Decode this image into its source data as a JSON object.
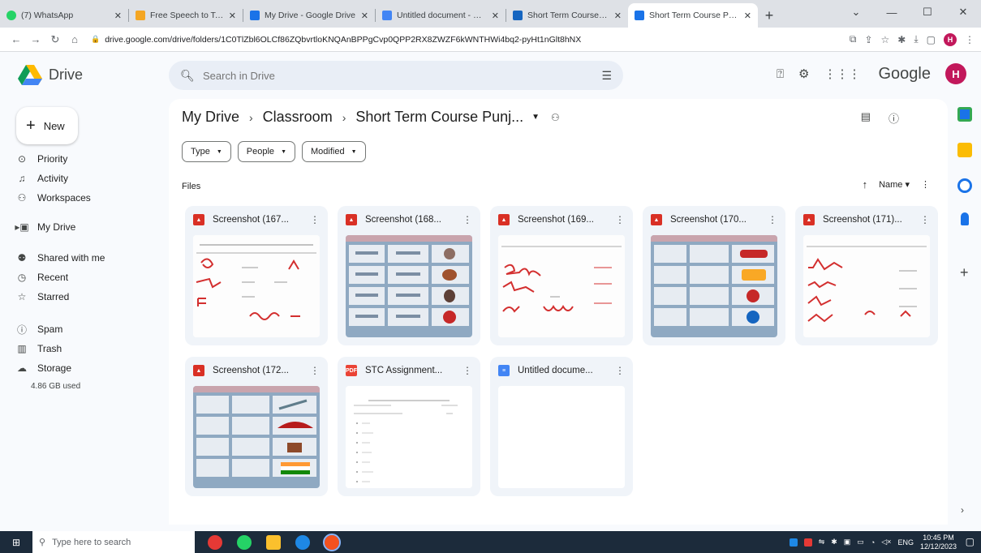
{
  "browser": {
    "tabs": [
      {
        "title": "(7) WhatsApp",
        "favicon_color": "#25d366",
        "active": false
      },
      {
        "title": "Free Speech to Text Online",
        "favicon_color": "#f4a623",
        "active": false
      },
      {
        "title": "My Drive - Google Drive",
        "favicon_color": "#1a73e8",
        "active": false
      },
      {
        "title": "Untitled document - Goog",
        "favicon_color": "#4285f4",
        "active": false
      },
      {
        "title": "Short Term Course Punjab",
        "favicon_color": "#1565c0",
        "active": false
      },
      {
        "title": "Short Term Course Punjab",
        "favicon_color": "#1a73e8",
        "active": true
      }
    ],
    "new_tab_glyph": "+",
    "url": "drive.google.com/drive/folders/1C0TlZbl6OLCf86ZQbvrtloKNQAnBPPgCvp0QPP2RX8ZWZF6kWNTHWi4bq2-pyHt1nGlt8hNX",
    "profile_initial": "H"
  },
  "drive": {
    "app_name": "Drive",
    "search_placeholder": "Search in Drive",
    "brand_word": "Google",
    "avatar_initial": "H",
    "new_label": "New",
    "nav": [
      {
        "label": "Priority",
        "icon": "priority-icon",
        "glyph": "⊙"
      },
      {
        "label": "Activity",
        "icon": "activity-icon",
        "glyph": "♫"
      },
      {
        "label": "Workspaces",
        "icon": "workspaces-icon",
        "glyph": "⚇"
      },
      {
        "label": "My Drive",
        "icon": "my-drive-icon",
        "glyph": "▣"
      },
      {
        "label": "Shared with me",
        "icon": "shared-icon",
        "glyph": "👥"
      },
      {
        "label": "Recent",
        "icon": "recent-icon",
        "glyph": "◷"
      },
      {
        "label": "Starred",
        "icon": "star-icon",
        "glyph": "☆"
      },
      {
        "label": "Spam",
        "icon": "spam-icon",
        "glyph": "ⓘ"
      },
      {
        "label": "Trash",
        "icon": "trash-icon",
        "glyph": "🗑"
      },
      {
        "label": "Storage",
        "icon": "cloud-icon",
        "glyph": "☁"
      }
    ],
    "storage_used": "4.86 GB used",
    "breadcrumb": [
      "My Drive",
      "Classroom",
      "Short Term Course Punj..."
    ],
    "filters": [
      "Type",
      "People",
      "Modified"
    ],
    "files_label": "Files",
    "sort_label": "Name",
    "files": [
      {
        "name": "Screenshot (167...",
        "type": "img"
      },
      {
        "name": "Screenshot (168...",
        "type": "img"
      },
      {
        "name": "Screenshot (169...",
        "type": "img"
      },
      {
        "name": "Screenshot (170...",
        "type": "img"
      },
      {
        "name": "Screenshot (171)...",
        "type": "img"
      },
      {
        "name": "Screenshot (172...",
        "type": "img"
      },
      {
        "name": "STC Assignment...",
        "type": "pdf"
      },
      {
        "name": "Untitled docume...",
        "type": "doc"
      }
    ]
  },
  "taskbar": {
    "search_placeholder": "Type here to search",
    "lang": "ENG",
    "time": "10:45 PM",
    "date": "12/12/2023"
  },
  "colors": {
    "accent": "#1a73e8",
    "avatar": "#c2185b",
    "image_file": "#d93025"
  }
}
